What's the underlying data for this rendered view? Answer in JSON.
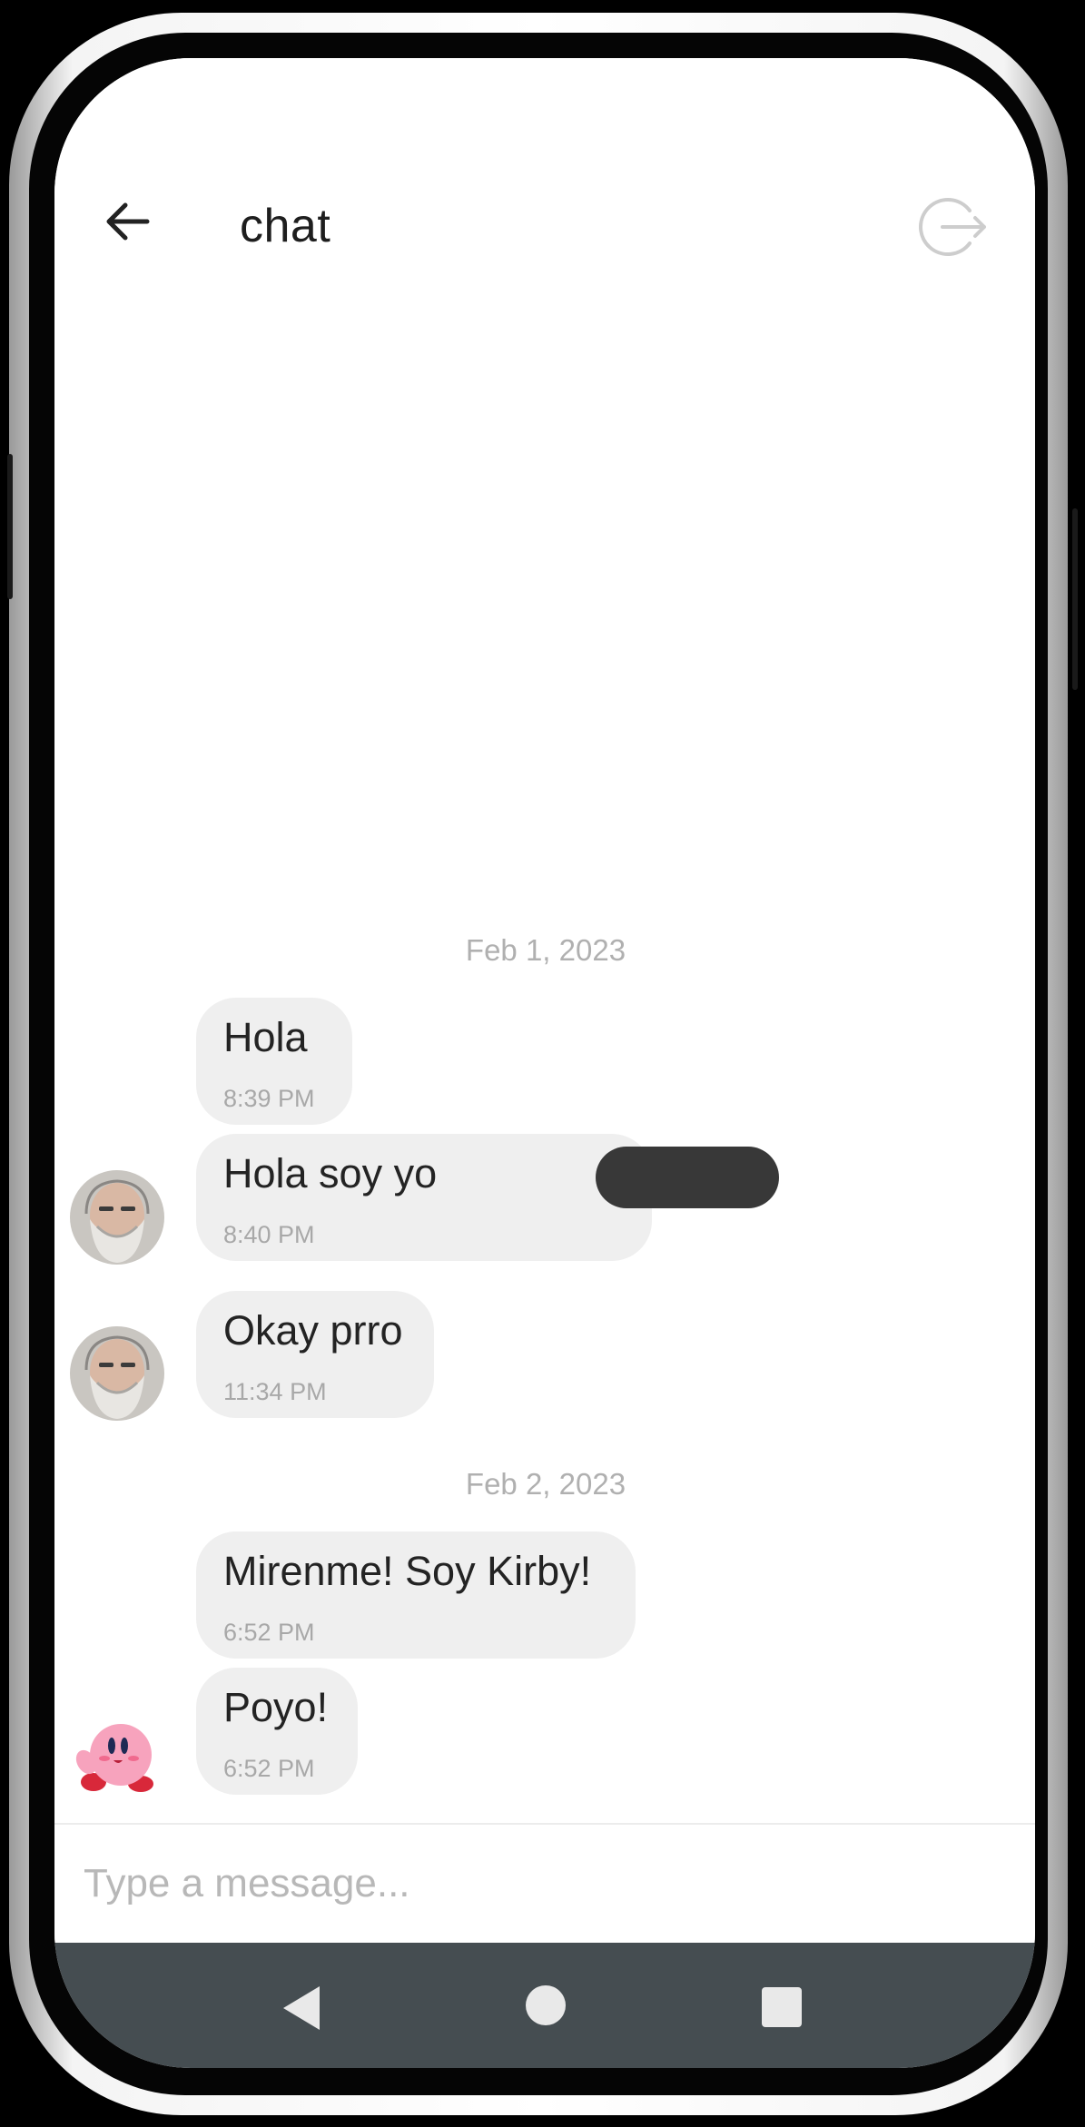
{
  "header": {
    "title": "chat",
    "back_icon": "arrow-left-icon",
    "logout_icon": "logout-icon"
  },
  "messages": [
    {
      "date": "Feb 1, 2023"
    },
    {
      "text": "Hola",
      "time": "8:39 PM",
      "sender": "user1"
    },
    {
      "text": "Hola soy yo",
      "time": "8:40 PM",
      "sender": "user1",
      "redacted": true
    },
    {
      "text": "Okay prro",
      "time": "11:34 PM",
      "sender": "user1"
    },
    {
      "date": "Feb 2, 2023"
    },
    {
      "text": "Mirenme! Soy Kirby!",
      "time": "6:52 PM",
      "sender": "kirby"
    },
    {
      "text": "Poyo!",
      "time": "6:52 PM",
      "sender": "kirby"
    }
  ],
  "composer": {
    "placeholder": "Type a message..."
  },
  "nav": {
    "back_icon": "nav-back-icon",
    "home_icon": "nav-home-icon",
    "recents_icon": "nav-recents-icon"
  },
  "colors": {
    "bubble": "#efefef",
    "nav_bar": "#454d51",
    "redaction": "#383838"
  }
}
